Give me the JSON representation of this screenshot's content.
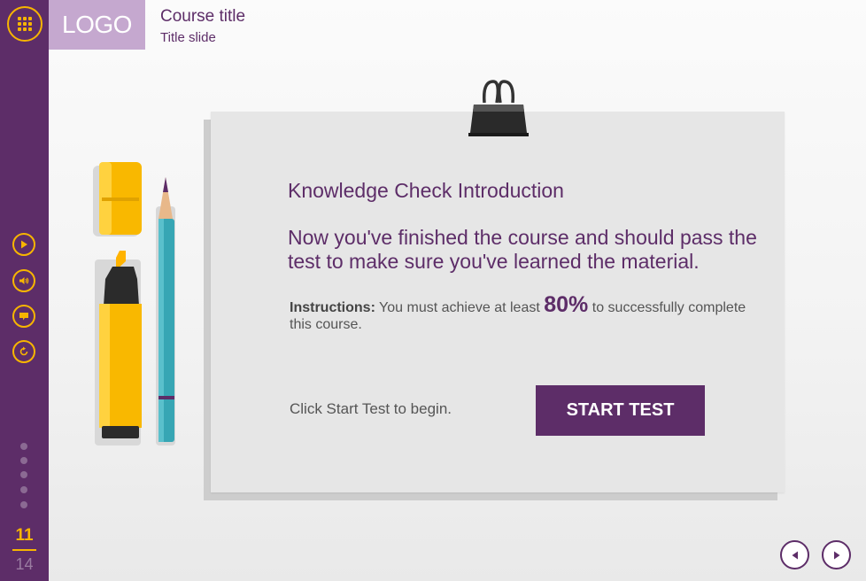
{
  "header": {
    "logo_text": "LOGO",
    "course_title": "Course title",
    "slide_title": "Title slide"
  },
  "sidebar": {
    "menu_icon": "grid-icon",
    "controls": [
      {
        "name": "play",
        "icon": "play-icon"
      },
      {
        "name": "audio",
        "icon": "volume-icon"
      },
      {
        "name": "captions",
        "icon": "speech-bubble-icon"
      },
      {
        "name": "replay",
        "icon": "replay-icon"
      }
    ],
    "page_current": "11",
    "page_total": "14"
  },
  "card": {
    "title": "Knowledge Check Introduction",
    "body": "Now you've finished the course and should pass the test to make sure you've learned the material.",
    "instructions_label": "Instructions:",
    "instructions_pre": "You must achieve at least",
    "pass_mark": "80%",
    "instructions_post": "to successfully complete this course.",
    "begin_text": "Click Start Test to begin.",
    "start_button": "START TEST"
  },
  "colors": {
    "brand_purple": "#5d2d68",
    "accent_yellow": "#f7b500",
    "logo_bg": "#c5a8cf",
    "card_bg": "#e6e6e6"
  }
}
